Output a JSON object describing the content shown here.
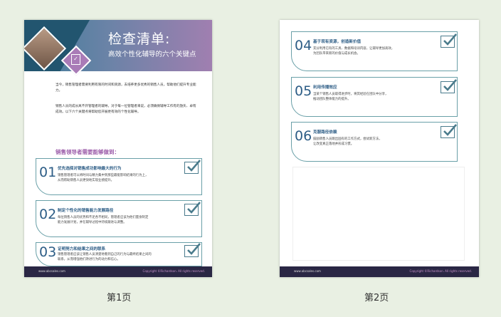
{
  "pages": [
    {
      "label": "第1页"
    },
    {
      "label": "第2页"
    }
  ],
  "header": {
    "title": "检查清单:",
    "subtitle": "高效个性化辅导的六个关键点"
  },
  "intro": [
    "当今，销售管理者需要利用有限的时间和资源，去培养更多优秀的销售人员，帮助他们提升专业能力。",
    "销售人员的成长离不开管理者的辅导。对于每一位管理者来说，必须确保辅导工作有的放矢、卓有成效。以下六个关键点将帮助您开展更有效的个性化辅导。"
  ],
  "subhead": "销售领导者需要能够做到：",
  "items": [
    {
      "num": "01",
      "title": "优先选择对销售成功影响最大的行为",
      "body": [
        "销售管理者可以将时间与精力集中到那些最能影响结果的行为上，",
        "从而帮助销售人员更快地实现业绩提升。"
      ]
    },
    {
      "num": "02",
      "title": "制定个性化的销售能力发展路径",
      "body": [
        "每位销售人员的优势和不足各不相同，管理者应该为他们量身制定",
        "能力发展计划，并在辅导过程中持续跟进与调整。"
      ]
    },
    {
      "num": "03",
      "title": "证明努力和结果之间的联系",
      "body": [
        "销售管理者应该让销售人员清楚地看到自己的行为与最终结果之间的",
        "联系，从而增强他们改进行为的动力和信心。"
      ]
    },
    {
      "num": "04",
      "title": "基于现有资源，创造新价值",
      "body": [
        "充分利用已有的工具、数据和培训内容，让辅导更加高效，",
        "为团队带来新的价值与成长机会。"
      ]
    },
    {
      "num": "05",
      "title": "利用传播效应",
      "body": [
        "当某个销售人员取得进步时，将其经验在团队中分享，",
        "推动团队整体能力的提升。"
      ]
    },
    {
      "num": "06",
      "title": "克服路径依赖",
      "body": [
        "鼓励销售人员跳出固有的工作方式，尝试新方法，",
        "让改变真正落地并形成习惯。"
      ]
    }
  ],
  "footer": {
    "url": "www.abcsales.com",
    "copyright": "Copyright ©Richardson. All rights reserved."
  }
}
